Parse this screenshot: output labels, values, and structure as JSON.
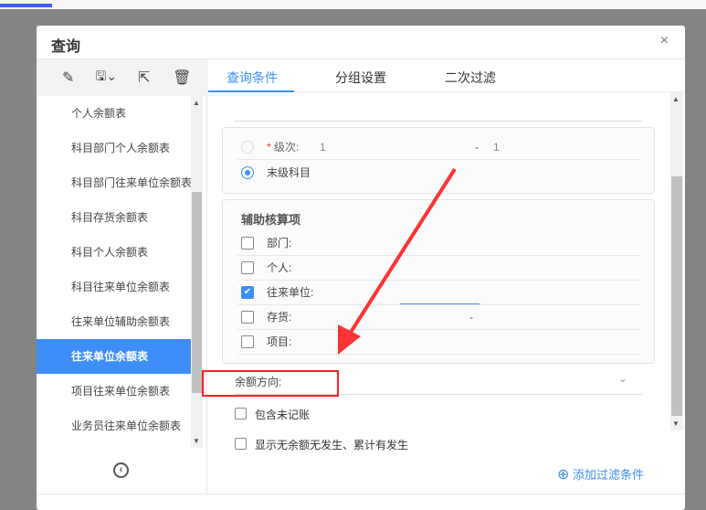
{
  "dialog": {
    "title": "查询",
    "close": "×"
  },
  "toolbar": {
    "edit": "✎",
    "save": "🖫⌄",
    "export": "⇱",
    "delete": "🗑"
  },
  "list": {
    "items": [
      "个人余额表",
      "科目部门个人余额表",
      "科目部门往来单位余额表",
      "科目存货余额表",
      "科目个人余额表",
      "科目往来单位余额表",
      "往来单位辅助余额表",
      "往来单位余额表",
      "项目往来单位余额表",
      "业务员往来单位余额表"
    ],
    "selected_index": 7
  },
  "tabs": [
    "查询条件",
    "分组设置",
    "二次过滤"
  ],
  "level": {
    "required": "*",
    "label": "级次:",
    "from": "1",
    "dash": "-",
    "to": "1",
    "last_level": "末级科目"
  },
  "aux": {
    "title": "辅助核算项",
    "items": [
      {
        "label": "部门:",
        "checked": false
      },
      {
        "label": "个人:",
        "checked": false
      },
      {
        "label": "往来单位:",
        "checked": true
      },
      {
        "label": "存货:",
        "checked": false,
        "value": "-"
      },
      {
        "label": "项目:",
        "checked": false
      }
    ]
  },
  "balance_direction": {
    "label": "余额方向:",
    "chevron": "⌄"
  },
  "options": {
    "include_unposted": "包含未记账",
    "show_zero": "显示无余额无发生、累计有发生"
  },
  "add_filter": {
    "icon": "⊕",
    "label": "添加过滤条件"
  }
}
